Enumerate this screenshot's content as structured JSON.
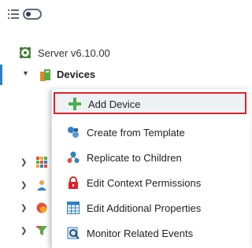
{
  "toolbar": {
    "list_icon": "list-icon",
    "toggle_icon": "toggle-icon"
  },
  "tree": {
    "server_label": "Server v6.10.00",
    "devices_label": "Devices"
  },
  "menu": {
    "items": [
      {
        "label": "Add Device",
        "icon": "plus-icon"
      },
      {
        "label": "Create from Template",
        "icon": "template-icon"
      },
      {
        "label": "Replicate to Children",
        "icon": "replicate-icon"
      },
      {
        "label": "Edit Context Permissions",
        "icon": "lock-icon"
      },
      {
        "label": "Edit Additional Properties",
        "icon": "table-icon"
      },
      {
        "label": "Monitor Related Events",
        "icon": "monitor-events-icon"
      }
    ]
  },
  "colors": {
    "accent": "#2d80c8",
    "highlight_border": "#e0212a",
    "plus": "#4caf50"
  }
}
